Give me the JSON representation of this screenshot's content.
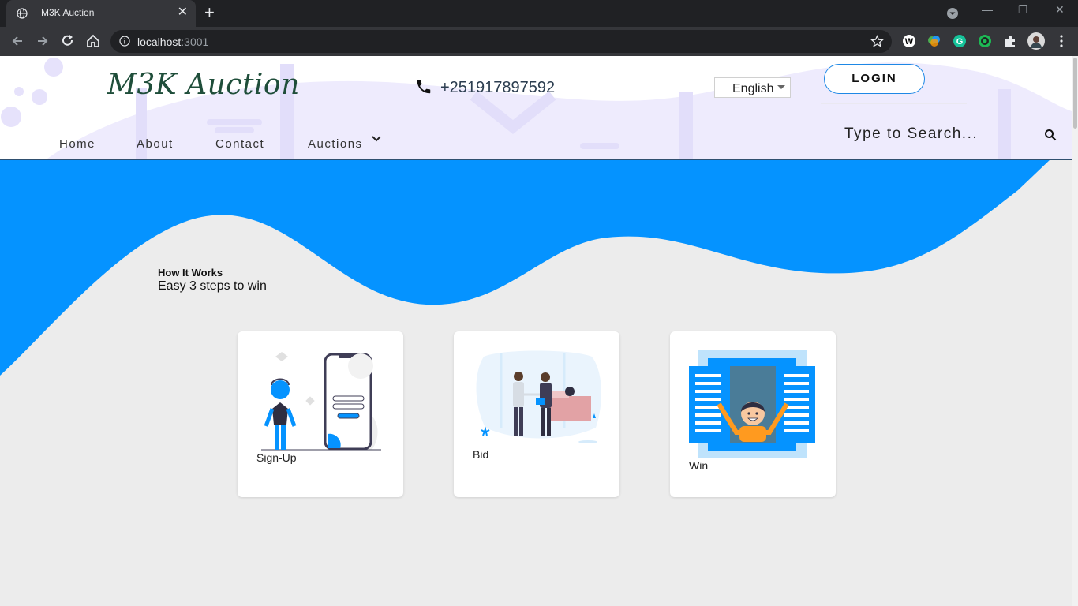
{
  "browser": {
    "tab_title": "M3K Auction",
    "tab_close_glyph": "✕",
    "new_tab_glyph": "+",
    "url_host": "localhost",
    "url_port": ":3001",
    "win_min": "—",
    "win_restore": "❐",
    "win_close": "✕"
  },
  "header": {
    "logo": "M3K Auction",
    "phone": "+251917897592",
    "language": "English",
    "login_label": "LOGIN",
    "search_placeholder": "Type to Search...",
    "nav": [
      "Home",
      "About",
      "Contact",
      "Auctions"
    ]
  },
  "how_it_works": {
    "title": "How It Works",
    "subtitle": "Easy 3 steps to win",
    "steps": [
      "Sign-Up",
      "Bid",
      "Win"
    ]
  },
  "colors": {
    "accent_blue": "#0593ff",
    "logo_green": "#1f4e3a",
    "chrome_dark": "#202124"
  }
}
